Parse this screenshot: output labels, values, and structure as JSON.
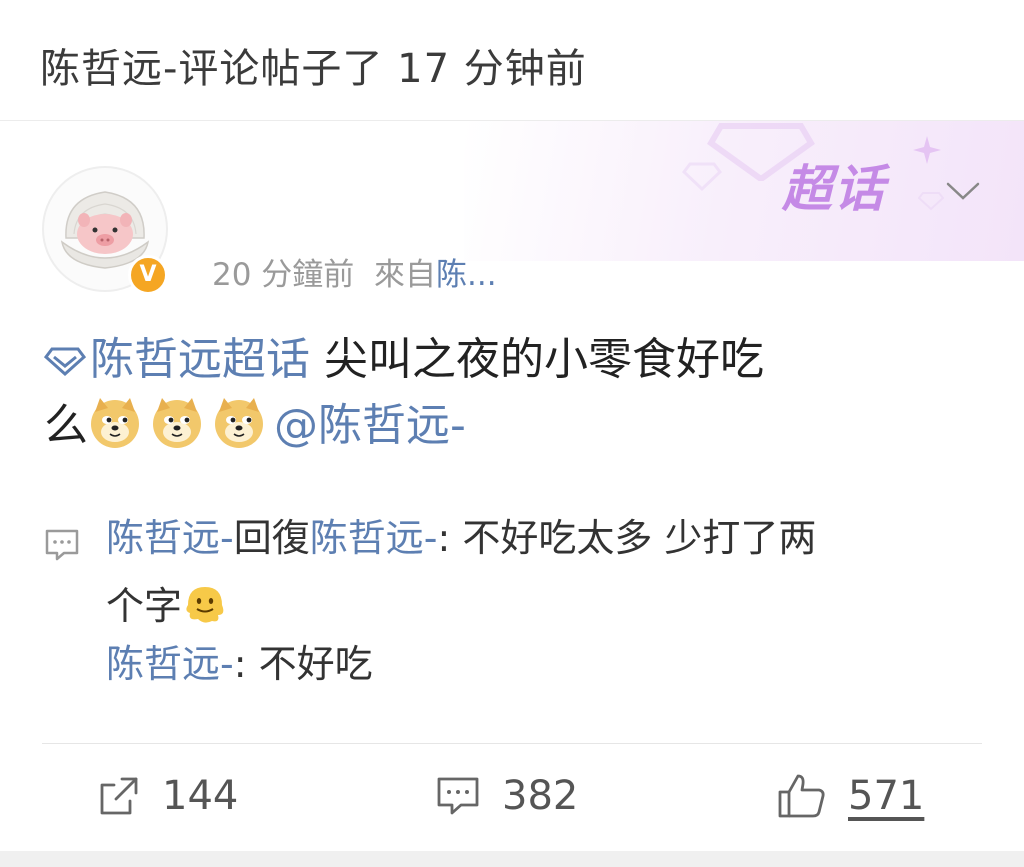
{
  "header": {
    "title": "陈哲远-评论帖子了 17 分钟前"
  },
  "topic_badge": {
    "label": "超话",
    "icon": "diamond-icon",
    "color": "#c58ae6"
  },
  "author": {
    "avatar_icon": "pig-in-shell-avatar",
    "verified_badge": "V",
    "time": "20 分鐘前",
    "source_prefix": "來自",
    "source": "陈..."
  },
  "post": {
    "topic_tag": "陈哲远超话",
    "text_line1": " 尖叫之夜的小零食好吃",
    "text_line2": "么",
    "emojis": [
      "doge-emoji",
      "doge-emoji",
      "doge-emoji"
    ],
    "mention": "@陈哲远-"
  },
  "comments": [
    {
      "author": "陈哲远-",
      "reply_word": "回復",
      "reply_to": "陈哲远-",
      "colon": ":",
      "text": " 不好吃太多 少打了两",
      "text_cont": "个字",
      "emoji": "melting-face-emoji"
    },
    {
      "author": "陈哲远-",
      "colon": ":",
      "text": " 不好吃"
    }
  ],
  "actions": {
    "share_count": "144",
    "comment_count": "382",
    "like_count": "571"
  },
  "colors": {
    "link": "#5d7fb2",
    "meta": "#9a9a9a",
    "badge": "#f5a623"
  }
}
